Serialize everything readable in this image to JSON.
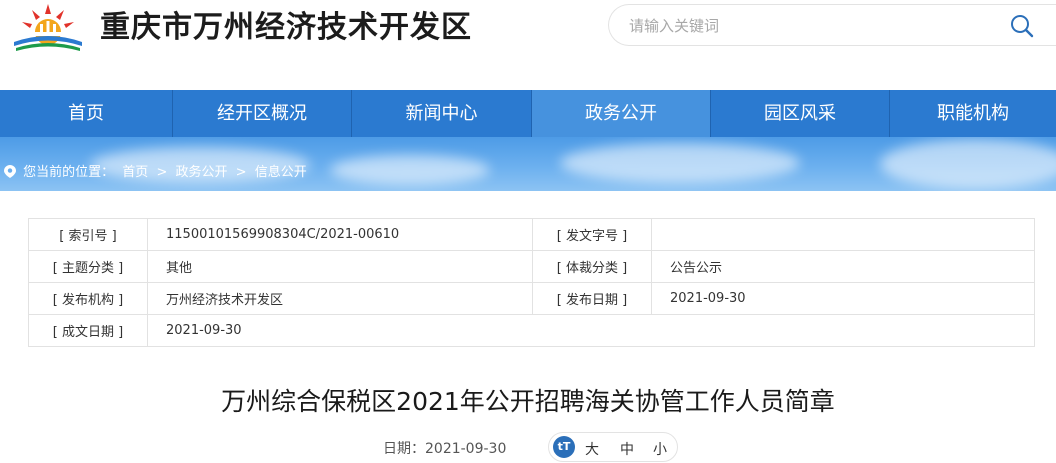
{
  "header": {
    "site_title": "重庆市万州经济技术开发区",
    "search_placeholder": "请输入关键词"
  },
  "nav": {
    "items": [
      {
        "label": "首页"
      },
      {
        "label": "经开区概况"
      },
      {
        "label": "新闻中心"
      },
      {
        "label": "政务公开"
      },
      {
        "label": "园区风采"
      },
      {
        "label": "职能机构"
      }
    ],
    "active_index": 3
  },
  "breadcrumb": {
    "prefix": "您当前的位置：",
    "items": [
      "首页",
      "政务公开",
      "信息公开"
    ],
    "separator": ">"
  },
  "info": {
    "index_label": "[ 索引号 ]",
    "index_value": "11500101569908304C/2021-00610",
    "doc_no_label": "[ 发文字号 ]",
    "doc_no_value": "",
    "topic_label": "[ 主题分类 ]",
    "topic_value": "其他",
    "genre_label": "[ 体裁分类 ]",
    "genre_value": "公告公示",
    "issuer_label": "[ 发布机构 ]",
    "issuer_value": "万州经济技术开发区",
    "publish_label": "[ 发布日期 ]",
    "publish_value": "2021-09-30",
    "created_label": "[ 成文日期 ]",
    "created_value": "2021-09-30"
  },
  "article": {
    "title": "万州综合保税区2021年公开招聘海关协管工作人员简章",
    "date_text": "日期：2021-09-30",
    "font_icon": "tT",
    "font_large": "大",
    "font_medium": "中",
    "font_small": "小"
  },
  "colors": {
    "nav_bg": "#2b7ad0",
    "nav_active": "#4692de",
    "accent": "#2b6fb9"
  }
}
